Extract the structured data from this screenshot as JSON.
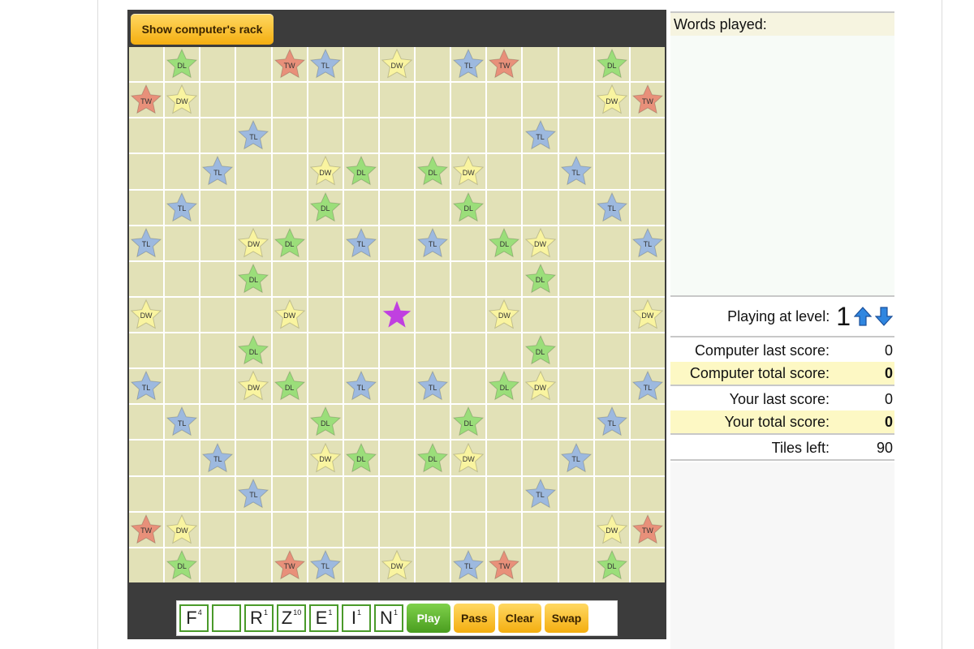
{
  "header": {
    "show_rack_label": "Show computer's rack"
  },
  "premium_colors": {
    "TW": "#e8907a",
    "DW": "#f9f4a0",
    "TL": "#9db9df",
    "DL": "#9bde7a",
    "center": "#c040e0"
  },
  "board": {
    "size": 15,
    "premiums": [
      [
        "",
        "DL",
        "",
        "",
        "TW",
        "TL",
        "",
        "DW",
        "",
        "TL",
        "TW",
        "",
        "",
        "DL",
        ""
      ],
      [
        "TW",
        "DW",
        "",
        "",
        "",
        "",
        "",
        "",
        "",
        "",
        "",
        "",
        "",
        "DW",
        "TW"
      ],
      [
        "",
        "",
        "",
        "TL",
        "",
        "",
        "",
        "",
        "",
        "",
        "",
        "TL",
        "",
        "",
        ""
      ],
      [
        "",
        "",
        "TL",
        "",
        "",
        "DW",
        "DL",
        "",
        "DL",
        "DW",
        "",
        "",
        "TL",
        "",
        ""
      ],
      [
        "",
        "TL",
        "",
        "",
        "",
        "DL",
        "",
        "",
        "",
        "DL",
        "",
        "",
        "",
        "TL",
        ""
      ],
      [
        "TL",
        "",
        "",
        "DW",
        "DL",
        "",
        "TL",
        "",
        "TL",
        "",
        "DL",
        "DW",
        "",
        "",
        "TL"
      ],
      [
        "",
        "",
        "",
        "DL",
        "",
        "",
        "",
        "",
        "",
        "",
        "",
        "DL",
        "",
        "",
        ""
      ],
      [
        "DW",
        "",
        "",
        "",
        "DW",
        "",
        "",
        "*",
        "",
        "",
        "DW",
        "",
        "",
        "",
        "DW"
      ],
      [
        "",
        "",
        "",
        "DL",
        "",
        "",
        "",
        "",
        "",
        "",
        "",
        "DL",
        "",
        "",
        ""
      ],
      [
        "TL",
        "",
        "",
        "DW",
        "DL",
        "",
        "TL",
        "",
        "TL",
        "",
        "DL",
        "DW",
        "",
        "",
        "TL"
      ],
      [
        "",
        "TL",
        "",
        "",
        "",
        "DL",
        "",
        "",
        "",
        "DL",
        "",
        "",
        "",
        "TL",
        ""
      ],
      [
        "",
        "",
        "TL",
        "",
        "",
        "DW",
        "DL",
        "",
        "DL",
        "DW",
        "",
        "",
        "TL",
        "",
        ""
      ],
      [
        "",
        "",
        "",
        "TL",
        "",
        "",
        "",
        "",
        "",
        "",
        "",
        "TL",
        "",
        "",
        ""
      ],
      [
        "TW",
        "DW",
        "",
        "",
        "",
        "",
        "",
        "",
        "",
        "",
        "",
        "",
        "",
        "DW",
        "TW"
      ],
      [
        "",
        "DL",
        "",
        "",
        "TW",
        "TL",
        "",
        "DW",
        "",
        "TL",
        "TW",
        "",
        "",
        "DL",
        ""
      ]
    ]
  },
  "rack": {
    "tiles": [
      {
        "letter": "F",
        "points": "4"
      },
      {
        "letter": "",
        "points": ""
      },
      {
        "letter": "R",
        "points": "1"
      },
      {
        "letter": "Z",
        "points": "10"
      },
      {
        "letter": "E",
        "points": "1"
      },
      {
        "letter": "I",
        "points": "1"
      },
      {
        "letter": "N",
        "points": "1"
      }
    ],
    "play_label": "Play",
    "pass_label": "Pass",
    "clear_label": "Clear",
    "swap_label": "Swap"
  },
  "panel": {
    "words_played_label": "Words played:",
    "level_label": "Playing at level:",
    "level_value": "1",
    "computer_last_label": "Computer last score:",
    "computer_last_value": "0",
    "computer_total_label": "Computer total score:",
    "computer_total_value": "0",
    "your_last_label": "Your last score:",
    "your_last_value": "0",
    "your_total_label": "Your total score:",
    "your_total_value": "0",
    "tiles_left_label": "Tiles left:",
    "tiles_left_value": "90"
  }
}
